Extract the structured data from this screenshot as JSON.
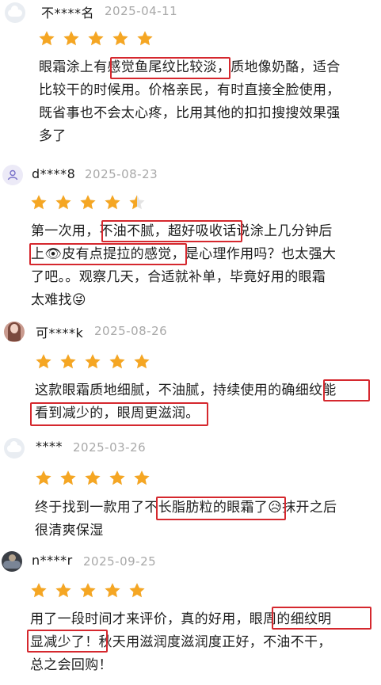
{
  "colors": {
    "star": "#f5a623",
    "highlight": "#d5282e",
    "date": "#a8a8a8"
  },
  "reviews": [
    {
      "user": "不****名",
      "date": "2025-04-11",
      "rating": 5,
      "avatar": "cloud-avatar",
      "lines": [
        "眼霜涂上有感觉鱼尾纹比较淡，质地像奶酪，适合",
        "比较干的时候用。价格亲民，有时直接全脸使用，",
        "既省事也不会太心疼，比用其他的扣扣搜搜效果强",
        "多了"
      ]
    },
    {
      "user": "d****8",
      "date": "2025-08-23",
      "rating": 4.5,
      "avatar": "user-icon",
      "lines": [
        "第一次用，不油不腻，超好吸收话说涂上几分钟后",
        "上👁皮有点提拉的感觉，是心理作用吗？也太强大",
        "了吧。。观察几天，合适就补单，毕竟好用的眼霜",
        "太难找😜"
      ]
    },
    {
      "user": "可****k",
      "date": "2025-08-26",
      "rating": 5,
      "avatar": "photo-avatar",
      "lines": [
        "这款眼霜质地细腻，不油腻，持续使用的确细纹能",
        "看到减少的，眼周更滋润。"
      ]
    },
    {
      "user": "****",
      "date": "2025-03-26",
      "rating": 5,
      "avatar": "cloud-avatar",
      "lines": [
        "终于找到一款用了不长脂肪粒的眼霜了😥抹开之后",
        "很清爽保湿"
      ]
    },
    {
      "user": "n****r",
      "date": "2025-09-25",
      "rating": 5,
      "avatar": "photo-avatar-dark",
      "lines": [
        "用了一段时间才来评价，真的好用，眼周的细纹明",
        "显减少了！秋天用滋润度滋润度正好，不油不干，",
        "总之会回购！"
      ]
    }
  ]
}
